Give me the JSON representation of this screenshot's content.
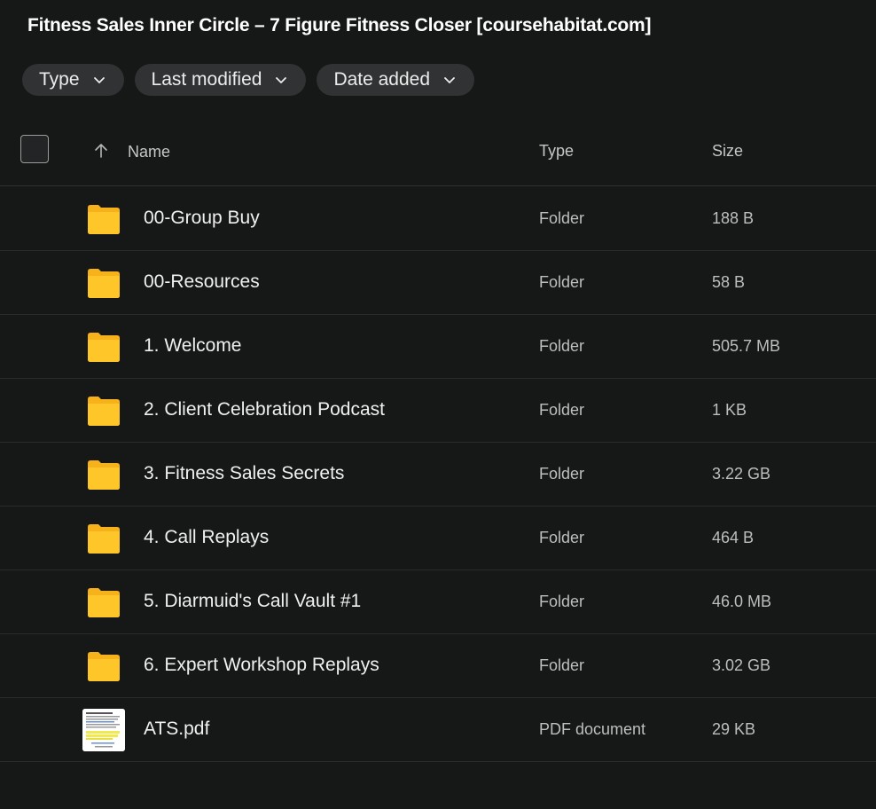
{
  "title": "Fitness Sales Inner Circle – 7 Figure Fitness Closer [coursehabitat.com]",
  "filters": [
    {
      "label": "Type",
      "icon": "chevron-down-icon"
    },
    {
      "label": "Last modified",
      "icon": "chevron-down-icon"
    },
    {
      "label": "Date added",
      "icon": "chevron-down-icon"
    }
  ],
  "table": {
    "columns": {
      "name": "Name",
      "type": "Type",
      "size": "Size"
    },
    "sort_icon": "arrow-up-icon",
    "rows": [
      {
        "name": "00-Group Buy",
        "type": "Folder",
        "size": "188 B",
        "icon": "folder-icon"
      },
      {
        "name": "00-Resources",
        "type": "Folder",
        "size": "58 B",
        "icon": "folder-icon"
      },
      {
        "name": "1. Welcome",
        "type": "Folder",
        "size": "505.7 MB",
        "icon": "folder-icon"
      },
      {
        "name": "2. Client Celebration Podcast",
        "type": "Folder",
        "size": "1 KB",
        "icon": "folder-icon"
      },
      {
        "name": "3. Fitness Sales Secrets",
        "type": "Folder",
        "size": "3.22 GB",
        "icon": "folder-icon"
      },
      {
        "name": "4. Call Replays",
        "type": "Folder",
        "size": "464 B",
        "icon": "folder-icon"
      },
      {
        "name": "5. Diarmuid's Call Vault #1",
        "type": "Folder",
        "size": "46.0 MB",
        "icon": "folder-icon"
      },
      {
        "name": "6. Expert Workshop Replays",
        "type": "Folder",
        "size": "3.02 GB",
        "icon": "folder-icon"
      },
      {
        "name": "ATS.pdf",
        "type": "PDF document",
        "size": "29 KB",
        "icon": "pdf-thumbnail"
      }
    ]
  },
  "colors": {
    "background": "#161717",
    "folder": "#f7b21b",
    "chip": "#303233"
  }
}
